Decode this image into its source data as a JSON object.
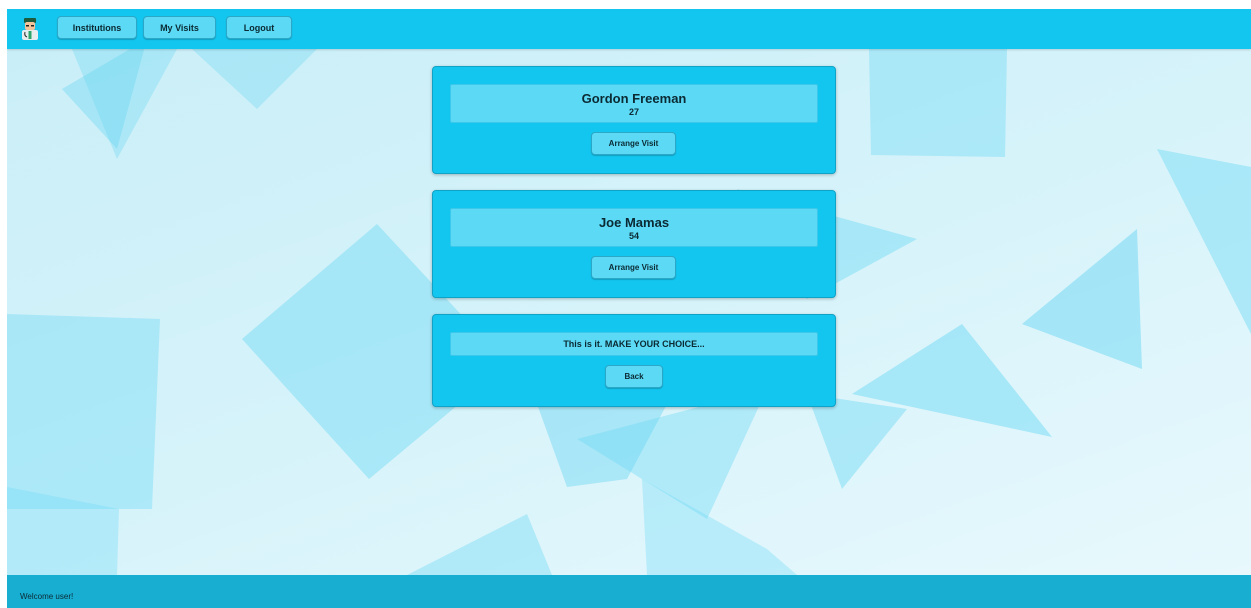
{
  "nav": {
    "logo_icon": "doctor-avatar-icon",
    "institutions_label": "Institutions",
    "my_visits_label": "My Visits",
    "logout_label": "Logout"
  },
  "persons": [
    {
      "name": "Gordon Freeman",
      "age": "27",
      "button_label": "Arrange Visit"
    },
    {
      "name": "Joe Mamas",
      "age": "54",
      "button_label": "Arrange Visit"
    }
  ],
  "choice": {
    "message": "This is it. MAKE YOUR CHOICE...",
    "back_label": "Back"
  },
  "footer": {
    "welcome_text": "Welcome user!"
  },
  "colors": {
    "primary": "#13c6ef",
    "button": "#5bd9f5",
    "footer": "#18aed2",
    "text": "#0b2a33"
  }
}
